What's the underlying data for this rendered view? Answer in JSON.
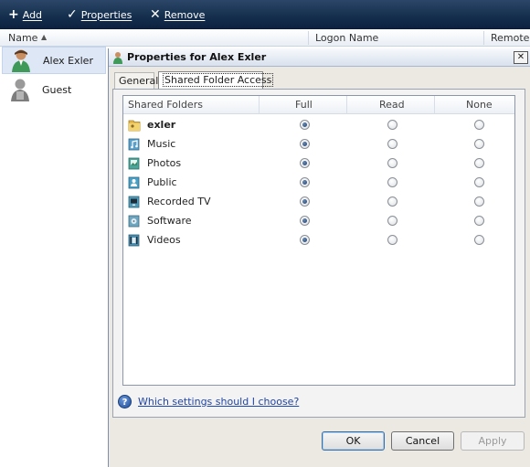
{
  "toolbar": {
    "add_label": "Add",
    "properties_label": "Properties",
    "remove_label": "Remove"
  },
  "columns": {
    "name": "Name",
    "logon_name": "Logon Name",
    "remote": "Remote A"
  },
  "users": [
    {
      "name": "Alex Exler",
      "selected": true
    },
    {
      "name": "Guest",
      "selected": false
    }
  ],
  "dialog": {
    "title": "Properties for Alex Exler",
    "close_glyph": "✕",
    "tabs": [
      {
        "label": "General",
        "active": false
      },
      {
        "label": "Shared Folder Access",
        "active": true
      }
    ],
    "list_headers": {
      "folders": "Shared Folders",
      "full": "Full",
      "read": "Read",
      "none": "None"
    },
    "folders": [
      {
        "name": "exler",
        "access": "full",
        "icon": "user-folder-icon"
      },
      {
        "name": "Music",
        "access": "full",
        "icon": "music-folder-icon"
      },
      {
        "name": "Photos",
        "access": "full",
        "icon": "photos-folder-icon"
      },
      {
        "name": "Public",
        "access": "full",
        "icon": "public-folder-icon"
      },
      {
        "name": "Recorded TV",
        "access": "full",
        "icon": "recorded-tv-folder-icon"
      },
      {
        "name": "Software",
        "access": "full",
        "icon": "software-folder-icon"
      },
      {
        "name": "Videos",
        "access": "full",
        "icon": "videos-folder-icon"
      }
    ],
    "help_text": "Which settings should I choose?",
    "buttons": {
      "ok": "OK",
      "cancel": "Cancel",
      "apply": "Apply"
    }
  },
  "colors": {
    "toolbar_bg": "#16304f",
    "dialog_bg": "#ece9e2",
    "link": "#1f45a8"
  }
}
